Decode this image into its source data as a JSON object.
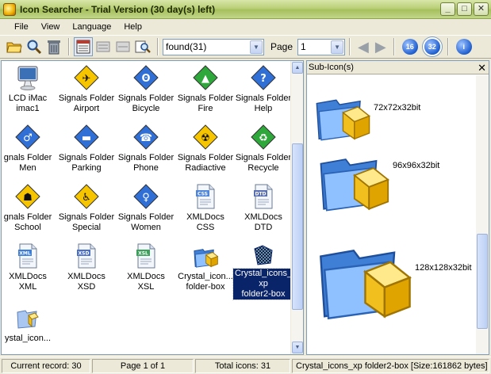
{
  "window": {
    "title": "Icon Searcher - Trial Version (30 day(s) left)"
  },
  "menu": [
    "File",
    "View",
    "Language",
    "Help"
  ],
  "toolbar": {
    "search_combo_value": "found(31)",
    "page_label": "Page",
    "page_value": "1",
    "btn_16": "16",
    "btn_32": "32",
    "btn_info": "i"
  },
  "icons": [
    {
      "line1": "LCD iMac",
      "line2": "imac1",
      "kind": "imac"
    },
    {
      "line1": "Signals Folder",
      "line2": "Airport",
      "kind": "sign-yellow",
      "glyph": "✈"
    },
    {
      "line1": "Signals Folder",
      "line2": "Bicycle",
      "kind": "sign-blue",
      "glyph": "ʘ"
    },
    {
      "line1": "Signals Folder",
      "line2": "Fire",
      "kind": "sign-green",
      "glyph": "▲"
    },
    {
      "line1": "Signals Folder",
      "line2": "Help",
      "kind": "sign-blue",
      "glyph": "?"
    },
    {
      "line1": "gnals Folder",
      "line2": "Men",
      "kind": "sign-blue",
      "glyph": "♂"
    },
    {
      "line1": "Signals Folder",
      "line2": "Parking",
      "kind": "sign-blue",
      "glyph": "▬"
    },
    {
      "line1": "Signals Folder",
      "line2": "Phone",
      "kind": "sign-blue",
      "glyph": "☎"
    },
    {
      "line1": "Signals Folder",
      "line2": "Radiactive",
      "kind": "sign-yellow",
      "glyph": "☢"
    },
    {
      "line1": "Signals Folder",
      "line2": "Recycle",
      "kind": "sign-green",
      "glyph": "♻"
    },
    {
      "line1": "gnals Folder",
      "line2": "School",
      "kind": "sign-yellow",
      "glyph": "☗"
    },
    {
      "line1": "Signals Folder",
      "line2": "Special",
      "kind": "sign-yellow",
      "glyph": "♿"
    },
    {
      "line1": "Signals Folder",
      "line2": "Women",
      "kind": "sign-blue",
      "glyph": "♀"
    },
    {
      "line1": "XMLDocs",
      "line2": "CSS",
      "kind": "doc",
      "tag": "CSS"
    },
    {
      "line1": "XMLDocs",
      "line2": "DTD",
      "kind": "doc",
      "tag": "DTD"
    },
    {
      "line1": "XMLDocs",
      "line2": "XML",
      "kind": "doc",
      "tag": "XML"
    },
    {
      "line1": "XMLDocs",
      "line2": "XSD",
      "kind": "doc",
      "tag": "XSD"
    },
    {
      "line1": "XMLDocs",
      "line2": "XSL",
      "kind": "doc",
      "tag": "XSL"
    },
    {
      "line1": "Crystal_icon...",
      "line2": "folder-box",
      "kind": "folderbox"
    },
    {
      "line1": "Crystal_icons_",
      "line2": "xp",
      "line3": "folder2-box",
      "kind": "checker",
      "selected": true
    },
    {
      "line1": "ystal_icon...",
      "line2": "",
      "kind": "ystal"
    }
  ],
  "sub_panel": {
    "title": "Sub-Icon(s)",
    "items": [
      {
        "label": "72x72x32bit"
      },
      {
        "label": "96x96x32bit"
      },
      {
        "label": "128x128x32bit"
      }
    ]
  },
  "status": {
    "current_record": "Current record: 30",
    "page_of": "Page 1 of 1",
    "total_icons": "Total icons: 31",
    "file_info": "Crystal_icons_xp folder2-box [Size:161862 bytes]"
  },
  "colors": {
    "title_bar": "#a6c05c",
    "selection": "#0a246a",
    "panel_border": "#7f9db9"
  }
}
